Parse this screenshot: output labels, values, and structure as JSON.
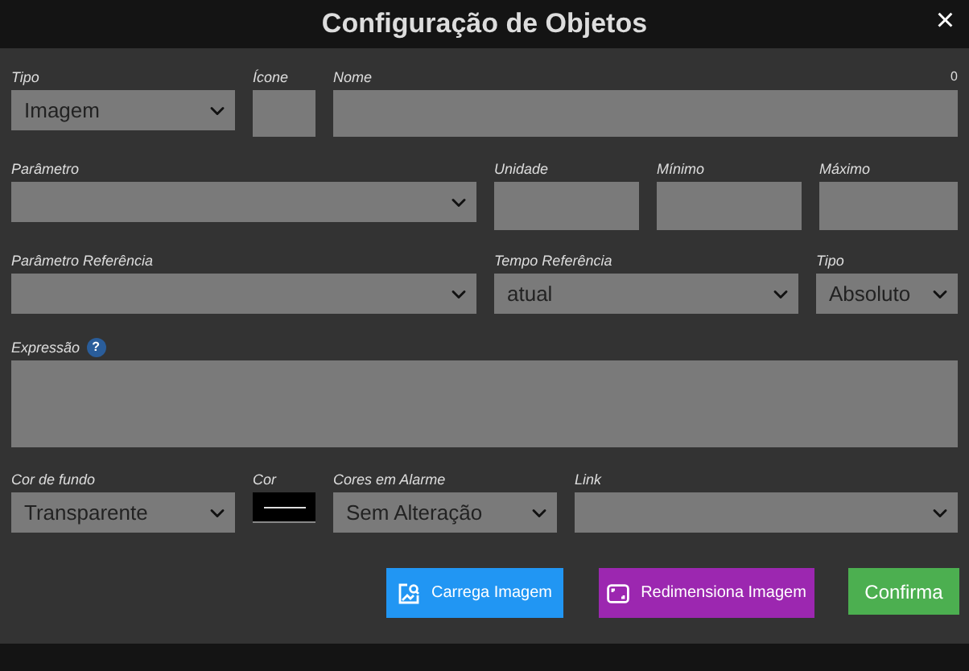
{
  "window": {
    "title": "Configuração de Objetos",
    "close": "×"
  },
  "rows": [
    {
      "fields": [
        {
          "kind": "select",
          "label": "Tipo",
          "value": "Imagem"
        },
        {
          "kind": "input",
          "label": "Ícone"
        },
        {
          "kind": "input",
          "label": "Nome",
          "counter": "0"
        }
      ]
    },
    {
      "fields": [
        {
          "kind": "select",
          "label": "Parâmetro"
        },
        {
          "kind": "input",
          "label": "Unidade"
        },
        {
          "kind": "input",
          "label": "Mínimo"
        },
        {
          "kind": "input",
          "label": "Máximo"
        }
      ]
    },
    {
      "fields": [
        {
          "kind": "select",
          "label": "Parâmetro Referência"
        },
        {
          "kind": "select",
          "label": "Tempo Referência",
          "value": "atual"
        },
        {
          "kind": "select",
          "label": "Tipo",
          "value": "Absoluto"
        }
      ]
    },
    {
      "fields": [
        {
          "kind": "textarea",
          "label": "Expressão",
          "help": "?"
        }
      ]
    },
    {
      "fields": [
        {
          "kind": "select",
          "label": "Cor de fundo",
          "value": "Transparente"
        },
        {
          "kind": "color",
          "label": "Cor",
          "color": "#000000"
        },
        {
          "kind": "select",
          "label": "Cores em Alarme",
          "value": "Sem Alteração"
        },
        {
          "kind": "select",
          "label": "Link"
        }
      ]
    }
  ],
  "buttons": [
    {
      "kind": "load",
      "label": "Carrega Imagem"
    },
    {
      "kind": "resize",
      "label": "Redimensiona Imagem"
    },
    {
      "kind": "confirm",
      "label": "Confirma"
    }
  ]
}
